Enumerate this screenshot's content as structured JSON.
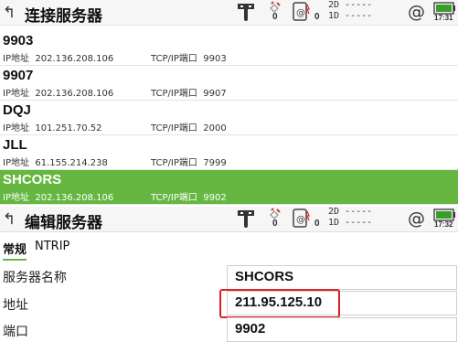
{
  "top_bar": {
    "back_icon": "back-arrow",
    "title": "连接服务器",
    "sat_count": "0",
    "link_count": "0",
    "diff_2d": "2D -----",
    "diff_1d": "1D -----",
    "battery_time": "17:31"
  },
  "servers": [
    {
      "name": "9903",
      "addr_label": "IP地址",
      "addr": "202.136.208.106",
      "port_label": "TCP/IP端口",
      "port": "9903"
    },
    {
      "name": "9907",
      "addr_label": "IP地址",
      "addr": "202.136.208.106",
      "port_label": "TCP/IP端口",
      "port": "9907"
    },
    {
      "name": "DQJ",
      "addr_label": "IP地址",
      "addr": "101.251.70.52",
      "port_label": "TCP/IP端口",
      "port": "2000"
    },
    {
      "name": "JLL",
      "addr_label": "IP地址",
      "addr": "61.155.214.238",
      "port_label": "TCP/IP端口",
      "port": "7999"
    },
    {
      "name": "SHCORS",
      "addr_label": "IP地址",
      "addr": "202.136.208.106",
      "port_label": "TCP/IP端口",
      "port": "9902",
      "selected": true
    }
  ],
  "bottom_bar": {
    "back_icon": "back-arrow",
    "title": "编辑服务器",
    "sat_count": "0",
    "link_count": "0",
    "diff_2d": "2D -----",
    "diff_1d": "1D -----",
    "battery_time": "17:32"
  },
  "tabs": {
    "general": "常规",
    "ntrip": "NTRIP"
  },
  "form": {
    "name_label": "服务器名称",
    "name_value": "SHCORS",
    "addr_label": "地址",
    "addr_value": "211.95.125.10",
    "port_label": "端口",
    "port_value": "9902"
  },
  "colors": {
    "selected_row": "#65b741",
    "highlight": "#e02020",
    "battery": "#3a9d2a"
  }
}
